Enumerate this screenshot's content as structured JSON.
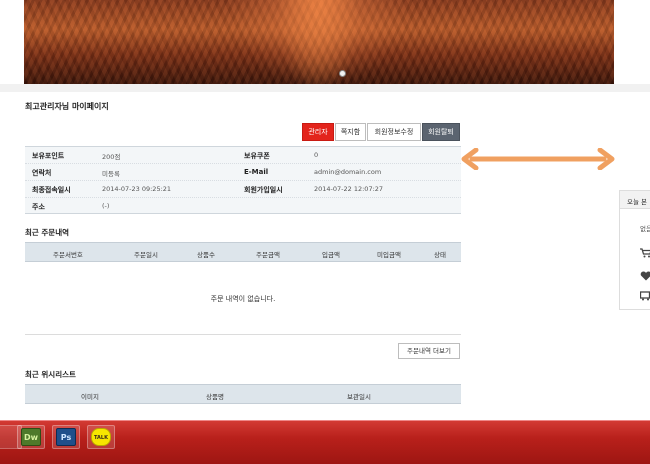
{
  "page": {
    "title": "최고관리자님 마이페이지"
  },
  "actions": {
    "admin": "관리자",
    "message": "쪽지함",
    "edit_info": "회원정보수정",
    "withdraw": "회원탈퇴"
  },
  "member_info": {
    "points_label": "보유포인트",
    "points_value": "200점",
    "coupon_label": "보유쿠폰",
    "coupon_value": "0",
    "contact_label": "연락처",
    "contact_value": "미등록",
    "email_label": "E-Mail",
    "email_value": "admin@domain.com",
    "last_login_label": "최종접속일시",
    "last_login_value": "2014-07-23 09:25:21",
    "joined_label": "회원가입일시",
    "joined_value": "2014-07-22 12:07:27",
    "address_label": "주소",
    "address_value": "(-)"
  },
  "orders": {
    "section_title": "최근 주문내역",
    "columns": [
      "주문서번호",
      "주문일시",
      "상품수",
      "주문금액",
      "입금액",
      "미입금액",
      "상태"
    ],
    "empty_message": "주문 내역이 없습니다.",
    "more_button": "주문내역 더보기"
  },
  "wishlist": {
    "section_title": "최근 위시리스트",
    "columns": [
      "이미지",
      "상품명",
      "보관일시"
    ]
  },
  "widget": {
    "title": "오늘 본",
    "empty_text": "없음"
  },
  "taskbar": {
    "apps": [
      "Dw",
      "Ps",
      "TALK"
    ]
  },
  "colors": {
    "admin_button": "#e3241c",
    "withdraw_button": "#5b6470",
    "arrow": "#f0a060",
    "taskbar": "#b8201b"
  }
}
